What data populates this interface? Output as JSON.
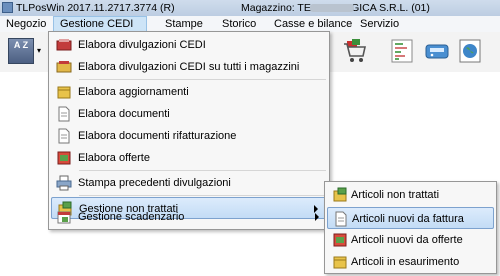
{
  "window": {
    "title_app": "TLPosWin 2017.11.2717.3774 (R)",
    "title_store": "Magazzino: TECNO LOGICA S.R.L. (01)",
    "blurred_suffix": ""
  },
  "menubar": {
    "items": [
      {
        "label": "Negozio"
      },
      {
        "label": "Gestione CEDI"
      },
      {
        "label": "Stampe"
      },
      {
        "label": "Storico"
      },
      {
        "label": "Casse e bilance"
      },
      {
        "label": "Servizio"
      }
    ],
    "active_index": 1
  },
  "toolbar": {
    "sort_label": "A Z",
    "dropdown_glyph": "▾"
  },
  "main_menu": {
    "items": [
      {
        "label": "Elabora divulgazioni CEDI",
        "icon": "red-crate-icon"
      },
      {
        "label": "Elabora divulgazioni CEDI su tutti i magazzini",
        "icon": "crate-icon"
      },
      {
        "label": "Elabora aggiornamenti",
        "icon": "cube-icon"
      },
      {
        "label": "Elabora documenti",
        "icon": "document-icon"
      },
      {
        "label": "Elabora documenti rifatturazione",
        "icon": "document-icon"
      },
      {
        "label": "Elabora offerte",
        "icon": "offer-icon"
      },
      {
        "label": "Stampa precedenti divulgazioni",
        "icon": "printer-icon"
      },
      {
        "label": "Gestione non trattati",
        "icon": "box-icon",
        "submenu": true
      },
      {
        "label": "Gestione scadenzario",
        "icon": "calendar-icon",
        "submenu": true
      }
    ],
    "highlighted_index": 7
  },
  "sub_menu": {
    "items": [
      {
        "label": "Articoli non trattati",
        "icon": "box-icon"
      },
      {
        "label": "Articoli nuovi da fattura",
        "icon": "document-icon"
      },
      {
        "label": "Articoli nuovi da offerte",
        "icon": "offer-icon"
      },
      {
        "label": "Articoli in esaurimento",
        "icon": "cube-icon"
      }
    ],
    "highlighted_index": 1
  },
  "colors": {
    "highlight": "#c3dcf5",
    "menu_bg": "#f7f7f7",
    "active_menu": "#cde4f7"
  }
}
